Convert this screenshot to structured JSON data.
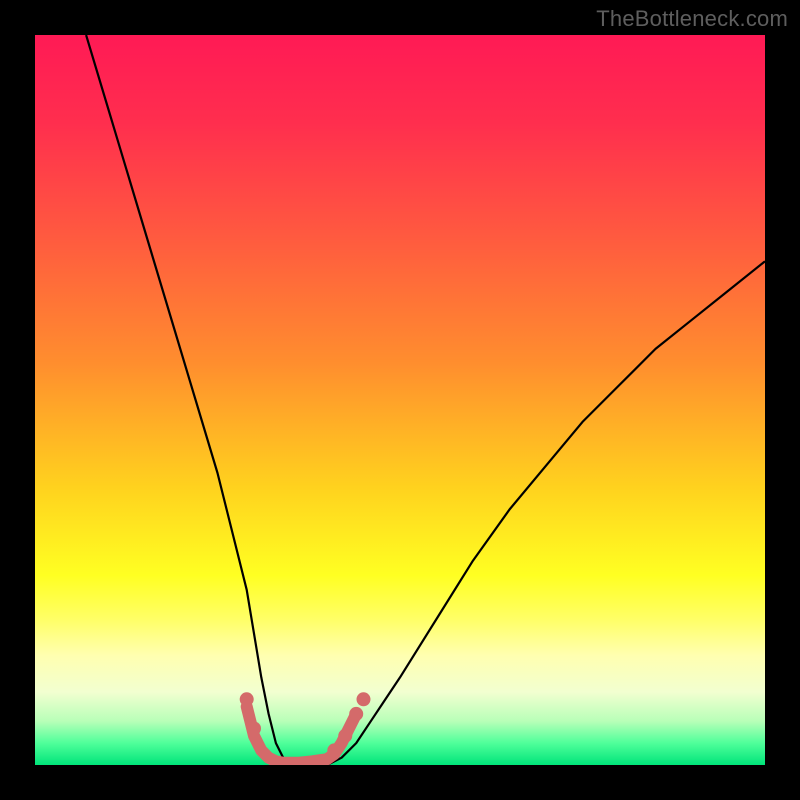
{
  "watermark": {
    "text": "TheBottleneck.com"
  },
  "chart_data": {
    "type": "line",
    "title": "",
    "xlabel": "",
    "ylabel": "",
    "xlim": [
      0,
      100
    ],
    "ylim": [
      0,
      100
    ],
    "grid": false,
    "background": {
      "type": "vertical-gradient",
      "stops": [
        {
          "offset": 0.0,
          "color": "#ff1a55"
        },
        {
          "offset": 0.12,
          "color": "#ff2e4e"
        },
        {
          "offset": 0.28,
          "color": "#ff5b3f"
        },
        {
          "offset": 0.45,
          "color": "#ff8e2e"
        },
        {
          "offset": 0.62,
          "color": "#ffd21e"
        },
        {
          "offset": 0.74,
          "color": "#ffff22"
        },
        {
          "offset": 0.8,
          "color": "#ffff66"
        },
        {
          "offset": 0.85,
          "color": "#ffffb0"
        },
        {
          "offset": 0.9,
          "color": "#f2ffd0"
        },
        {
          "offset": 0.94,
          "color": "#b8ffb8"
        },
        {
          "offset": 0.97,
          "color": "#4fff9a"
        },
        {
          "offset": 1.0,
          "color": "#00e47a"
        }
      ]
    },
    "series": [
      {
        "name": "bottleneck-curve",
        "color": "#000000",
        "width": 2.2,
        "x": [
          7,
          10,
          13,
          16,
          19,
          22,
          25,
          27,
          29,
          30,
          31,
          32,
          33,
          34,
          35,
          36,
          38,
          40,
          42,
          44,
          46,
          50,
          55,
          60,
          65,
          70,
          75,
          80,
          85,
          90,
          95,
          100
        ],
        "y": [
          100,
          90,
          80,
          70,
          60,
          50,
          40,
          32,
          24,
          18,
          12,
          7,
          3,
          1,
          0,
          0,
          0,
          0,
          1,
          3,
          6,
          12,
          20,
          28,
          35,
          41,
          47,
          52,
          57,
          61,
          65,
          69
        ]
      },
      {
        "name": "bottleneck-highlight",
        "color": "#d46a6a",
        "width": 12,
        "linecap": "round",
        "x": [
          29,
          30,
          31,
          32,
          33,
          34,
          35,
          36,
          38,
          40,
          41,
          42,
          43,
          44
        ],
        "y": [
          8,
          4,
          2,
          1,
          0.5,
          0.3,
          0.3,
          0.3,
          0.5,
          0.8,
          1.5,
          3,
          5,
          7
        ]
      }
    ],
    "highlight_dots": {
      "color": "#d46a6a",
      "radius": 7,
      "points": [
        {
          "x": 29.0,
          "y": 9
        },
        {
          "x": 30.0,
          "y": 5
        },
        {
          "x": 41.0,
          "y": 2
        },
        {
          "x": 42.5,
          "y": 4
        },
        {
          "x": 44.0,
          "y": 7
        },
        {
          "x": 45.0,
          "y": 9
        }
      ]
    }
  }
}
